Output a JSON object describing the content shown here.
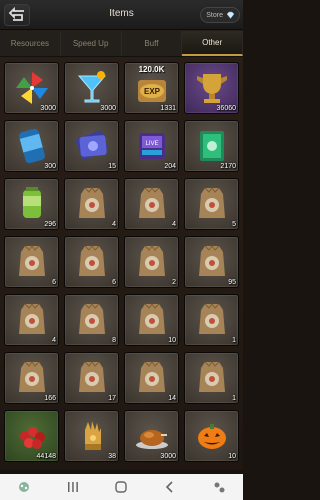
{
  "header": {
    "title": "Items",
    "store_label": "Store"
  },
  "tabs": [
    {
      "label": "Resources",
      "active": false
    },
    {
      "label": "Speed Up",
      "active": false
    },
    {
      "label": "Buff",
      "active": false
    },
    {
      "label": "Other",
      "active": true
    }
  ],
  "items": [
    {
      "icon": "pinwheel-icon",
      "rarity": "gray",
      "count": "3000"
    },
    {
      "icon": "cocktail-icon",
      "rarity": "gray",
      "count": "3000"
    },
    {
      "icon": "exp-scroll-icon",
      "rarity": "gray",
      "count": "1331",
      "badge": "120.0K"
    },
    {
      "icon": "gold-trophy-icon",
      "rarity": "purple",
      "count": "36060"
    },
    {
      "icon": "can-icon",
      "rarity": "gray",
      "count": "300"
    },
    {
      "icon": "card-pack-icon",
      "rarity": "gray",
      "count": "15"
    },
    {
      "icon": "live-pass-icon",
      "rarity": "gray",
      "count": "204"
    },
    {
      "icon": "green-book-icon",
      "rarity": "gray",
      "count": "2170"
    },
    {
      "icon": "green-canister-icon",
      "rarity": "gray",
      "count": "296"
    },
    {
      "icon": "seed-bag-icon",
      "rarity": "gray",
      "count": "4"
    },
    {
      "icon": "seed-bag-icon",
      "rarity": "gray",
      "count": "4"
    },
    {
      "icon": "seed-bag-icon",
      "rarity": "gray",
      "count": "5"
    },
    {
      "icon": "seed-bag-icon",
      "rarity": "gray",
      "count": "6"
    },
    {
      "icon": "seed-bag-icon",
      "rarity": "gray",
      "count": "6"
    },
    {
      "icon": "seed-bag-icon",
      "rarity": "gray",
      "count": "2"
    },
    {
      "icon": "seed-bag-icon",
      "rarity": "gray",
      "count": "95"
    },
    {
      "icon": "seed-bag-icon",
      "rarity": "gray",
      "count": "4"
    },
    {
      "icon": "seed-bag-icon",
      "rarity": "gray",
      "count": "8"
    },
    {
      "icon": "seed-bag-icon",
      "rarity": "gray",
      "count": "10"
    },
    {
      "icon": "seed-bag-icon",
      "rarity": "gray",
      "count": "1"
    },
    {
      "icon": "seed-bag-icon",
      "rarity": "gray",
      "count": "166"
    },
    {
      "icon": "seed-bag-icon",
      "rarity": "gray",
      "count": "17"
    },
    {
      "icon": "seed-bag-icon",
      "rarity": "gray",
      "count": "14"
    },
    {
      "icon": "seed-bag-icon",
      "rarity": "gray",
      "count": "1"
    },
    {
      "icon": "roses-icon",
      "rarity": "green",
      "count": "44148"
    },
    {
      "icon": "golden-glove-icon",
      "rarity": "gray",
      "count": "38"
    },
    {
      "icon": "roast-turkey-icon",
      "rarity": "gray",
      "count": "3000"
    },
    {
      "icon": "pumpkin-icon",
      "rarity": "gray",
      "count": "10"
    }
  ],
  "navbar": {
    "left_icon": "recents-icon",
    "home_icon": "home-icon",
    "back_icon": "back-icon"
  },
  "colors": {
    "accent": "#c59a3b",
    "tab_active_text": "#f0e6cf"
  }
}
